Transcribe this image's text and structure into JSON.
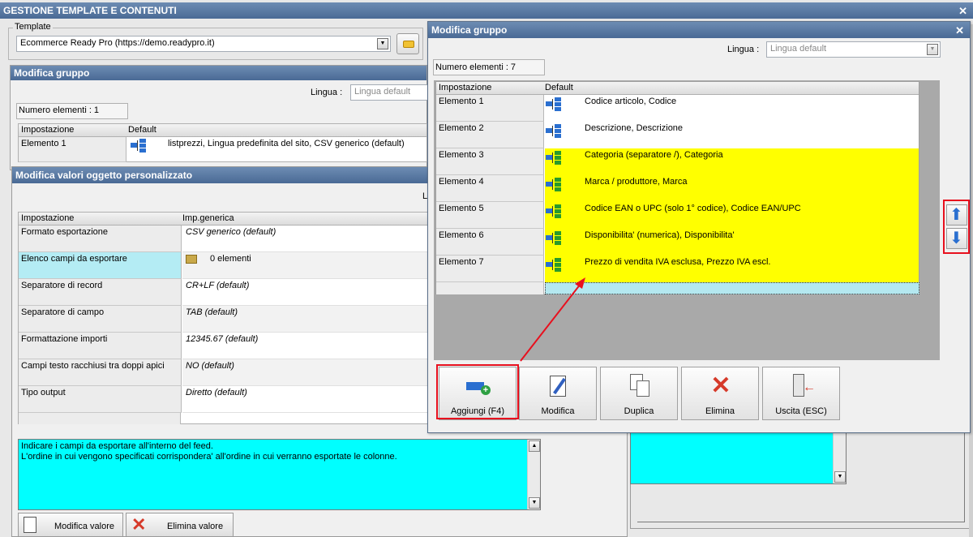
{
  "main_window": {
    "title": "GESTIONE TEMPLATE E CONTENUTI",
    "close": "✕"
  },
  "template": {
    "label": "Template",
    "value": "Ecommerce Ready Pro (https://demo.readypro.it)"
  },
  "bg_group": {
    "title": "Modifica gruppo",
    "lingua_label": "Lingua :",
    "lingua_value": "Lingua default",
    "count": "Numero elementi : 1",
    "col1": "Impostazione",
    "col2": "Default",
    "row_label": "Elemento 1",
    "row_value": "listprezzi, Lingua predefinita del sito, CSV generico (default)"
  },
  "values_window": {
    "title": "Modifica valori oggetto personalizzato",
    "lingua_label_partial": "Li",
    "col1": "Impostazione",
    "col2": "Imp.generica",
    "rows": [
      {
        "label": "Formato esportazione",
        "value": "CSV generico (default)"
      },
      {
        "label": "Elenco campi da esportare",
        "value": "0 elementi"
      },
      {
        "label": "Separatore di record",
        "value": "CR+LF (default)"
      },
      {
        "label": "Separatore di campo",
        "value": "TAB (default)"
      },
      {
        "label": "Formattazione importi",
        "value": "12345.67 (default)"
      },
      {
        "label": "Campi testo racchiusi tra doppi apici",
        "value": "NO (default)"
      },
      {
        "label": "Tipo output",
        "value": "Diretto (default)"
      }
    ],
    "description_line1": "Indicare i campi da esportare all'interno del feed.",
    "description_line2": "L'ordine in cui vengono specificati corrispondera' all'ordine in cui verranno esportate le colonne.",
    "btn_modifica": "Modifica valore",
    "btn_elimina": "Elimina valore"
  },
  "dialog": {
    "title": "Modifica gruppo",
    "close": "✕",
    "lingua_label": "Lingua :",
    "lingua_value": "Lingua default",
    "count": "Numero elementi : 7",
    "col1": "Impostazione",
    "col2": "Default",
    "rows": [
      {
        "label": "Elemento 1",
        "value": "Codice articolo, Codice",
        "highlight": false
      },
      {
        "label": "Elemento 2",
        "value": "Descrizione, Descrizione",
        "highlight": false
      },
      {
        "label": "Elemento 3",
        "value": "Categoria (separatore /), Categoria",
        "highlight": true
      },
      {
        "label": "Elemento 4",
        "value": "Marca / produttore, Marca",
        "highlight": true
      },
      {
        "label": "Elemento 5",
        "value": "Codice EAN o UPC (solo 1° codice), Codice EAN/UPC",
        "highlight": true
      },
      {
        "label": "Elemento 6",
        "value": "Disponibilita' (numerica), Disponibilita'",
        "highlight": true
      },
      {
        "label": "Elemento 7",
        "value": "Prezzo di vendita IVA esclusa, Prezzo IVA escl.",
        "highlight": true
      }
    ],
    "buttons": {
      "aggiungi": "Aggiungi (F4)",
      "modifica": "Modifica",
      "duplica": "Duplica",
      "elimina": "Elimina",
      "uscita": "Uscita (ESC)"
    }
  },
  "colors": {
    "highlight": "#ffff00",
    "annotation": "#e8101e",
    "cyan": "#00ffff",
    "titlebar": "#5878a3"
  }
}
